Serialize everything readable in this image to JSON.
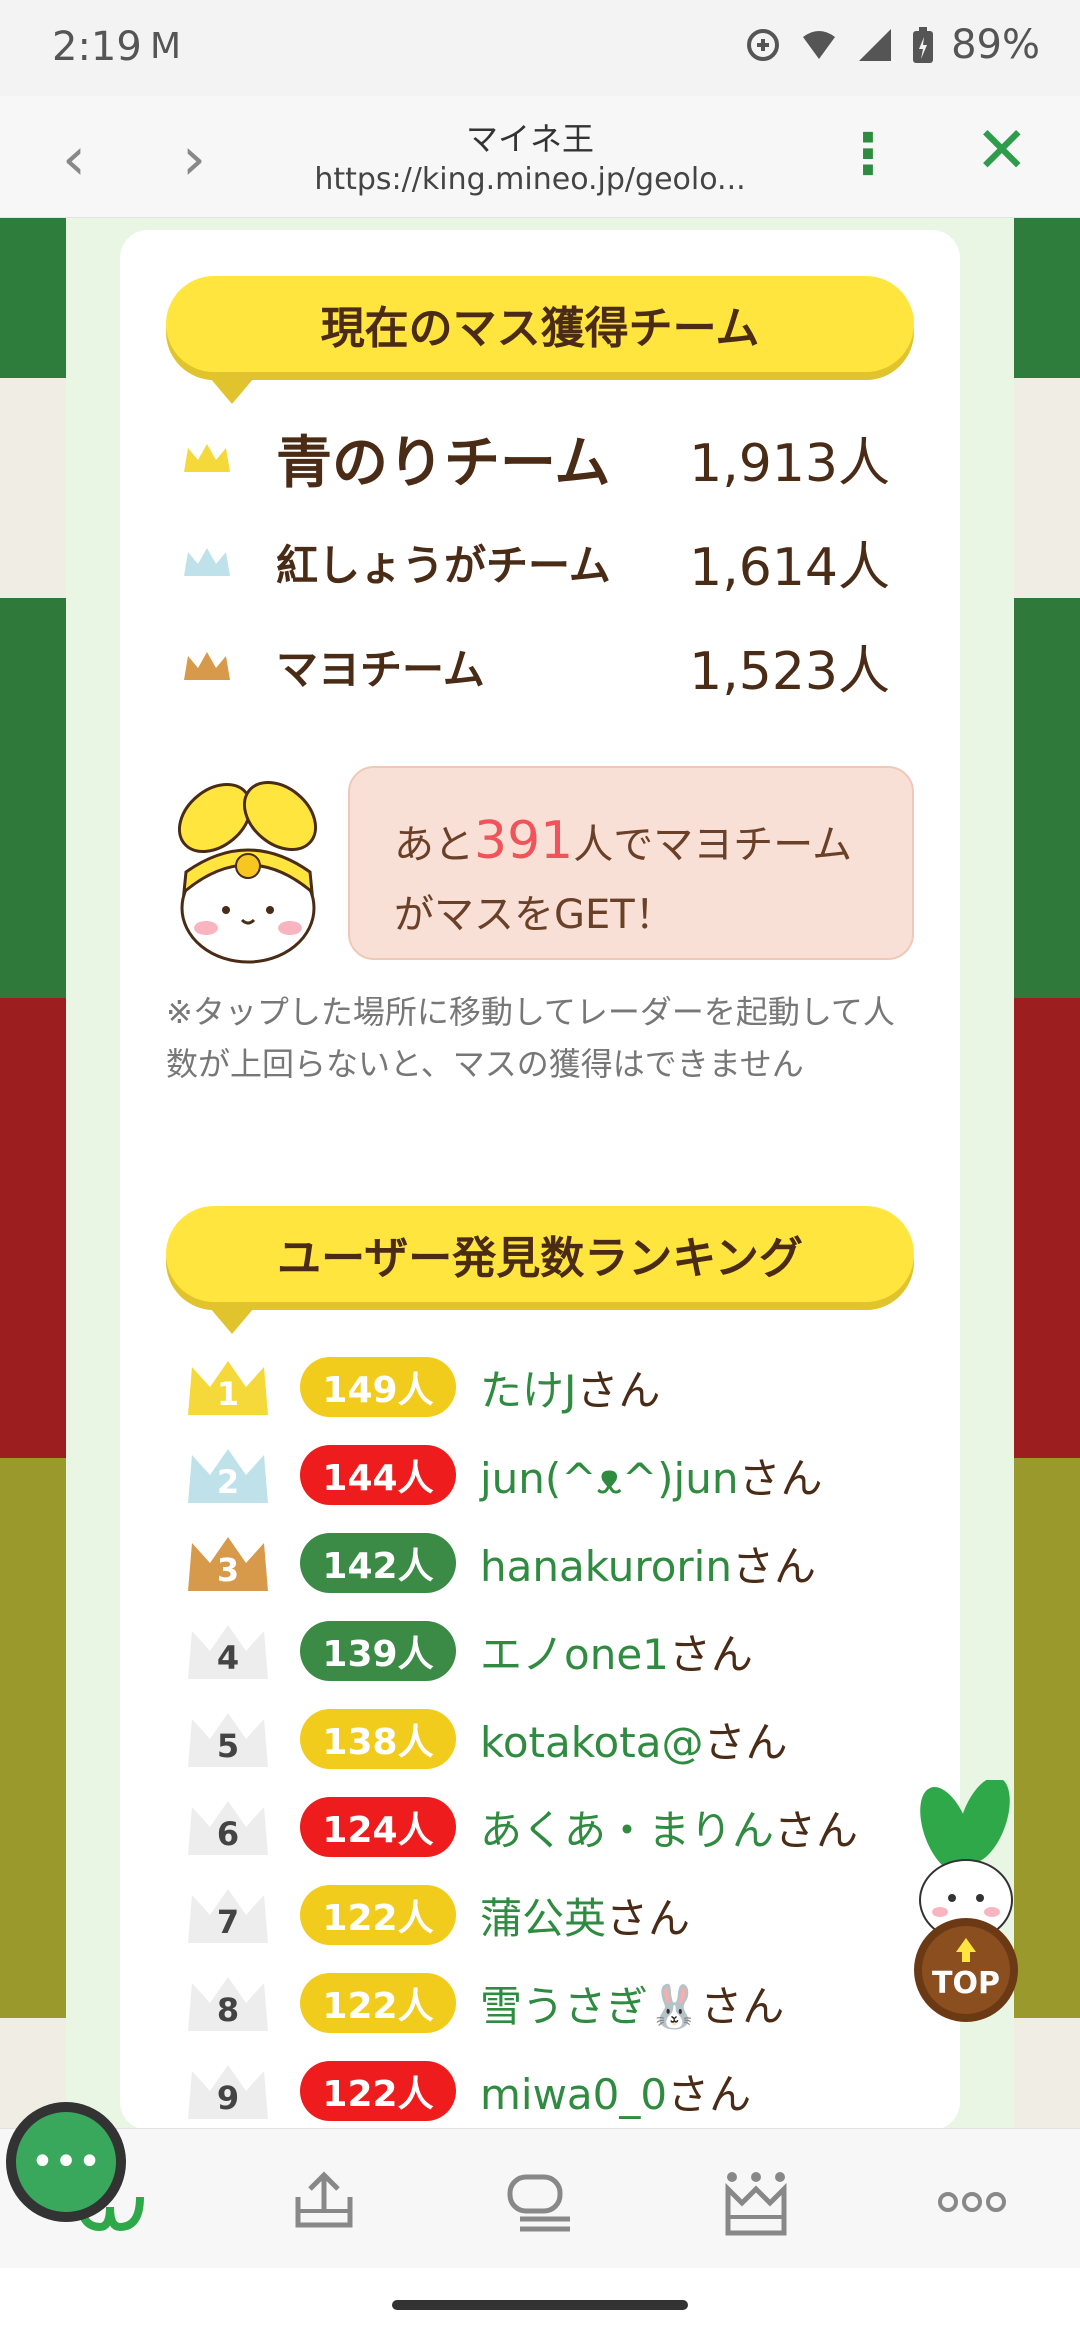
{
  "status": {
    "time": "2:19",
    "battery": "89%"
  },
  "toolbar": {
    "title": "マイネ王",
    "url": "https://king.mineo.jp/geolo..."
  },
  "section1": {
    "heading": "現在のマス獲得チーム"
  },
  "teams": [
    {
      "name": "青のりチーム",
      "count": "1,913人",
      "crown_color": "#f5d93b"
    },
    {
      "name": "紅しょうがチーム",
      "count": "1,614人",
      "crown_color": "#bfe2ea"
    },
    {
      "name": "マヨチーム",
      "count": "1,523人",
      "crown_color": "#d79a4a"
    }
  ],
  "notice": {
    "prefix": "あと",
    "number": "391",
    "suffix": "人でマヨチームがマスをGET！"
  },
  "note": "※タップした場所に移動してレーダーを起動して人数が上回らないと、マスの獲得はできません",
  "section2": {
    "heading": "ユーザー発見数ランキング"
  },
  "ranking": [
    {
      "rank": "1",
      "count": "149人",
      "name": "たけJ",
      "suffix": "さん",
      "badge_color": "#f2cc1c",
      "crown_color": "#f5d93b"
    },
    {
      "rank": "2",
      "count": "144人",
      "name": "jun(^ᴥ^)jun",
      "suffix": "さん",
      "badge_color": "#ee1c1c",
      "crown_color": "#bfe2ea"
    },
    {
      "rank": "3",
      "count": "142人",
      "name": "hanakurorin",
      "suffix": "さん",
      "badge_color": "#3b8a45",
      "crown_color": "#d79a4a"
    },
    {
      "rank": "4",
      "count": "139人",
      "name": "エノone1",
      "suffix": "さん",
      "badge_color": "#3b8a45",
      "crown_color": "#ededed"
    },
    {
      "rank": "5",
      "count": "138人",
      "name": "kotakota@",
      "suffix": "さん",
      "badge_color": "#f2cc1c",
      "crown_color": "#ededed"
    },
    {
      "rank": "6",
      "count": "124人",
      "name": "あくあ・まりん",
      "suffix": "さん",
      "badge_color": "#ee1c1c",
      "crown_color": "#ededed"
    },
    {
      "rank": "7",
      "count": "122人",
      "name": "蒲公英",
      "suffix": "さん",
      "badge_color": "#f2cc1c",
      "crown_color": "#ededed"
    },
    {
      "rank": "8",
      "count": "122人",
      "name": "雪うさぎ🐰",
      "suffix": "さん",
      "badge_color": "#f2cc1c",
      "crown_color": "#ededed"
    },
    {
      "rank": "9",
      "count": "122人",
      "name": "miwa0_0",
      "suffix": "さん",
      "badge_color": "#ee1c1c",
      "crown_color": "#ededed"
    }
  ],
  "top_button": {
    "label": "TOP"
  },
  "bottom_nav": [
    "home-icon",
    "upload-icon",
    "comments-icon",
    "ranking-icon",
    "more-icon"
  ],
  "fab": {
    "label": "•••"
  }
}
